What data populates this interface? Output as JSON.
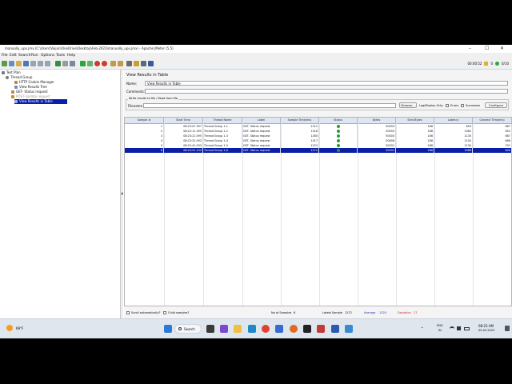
{
  "window": {
    "title": "manually_upo.jmx (C:\\Users\\Vaijan\\OneDrive\\Desktop\\Feb-2023\\manually_upo.jmx) - Apache JMeter (5.5)",
    "controls": [
      "–",
      "☐",
      "✕"
    ]
  },
  "menu": [
    "File",
    "Edit",
    "Search",
    "Run",
    "Options",
    "Tools",
    "Help"
  ],
  "toolbar": {
    "timer": "00:00:52",
    "warnings": "0",
    "threads": "0/10"
  },
  "tree": [
    {
      "label": "Test Plan",
      "icon": "test-plan-icon",
      "color": "#6e7f92"
    },
    {
      "label": "Thread Group",
      "icon": "gear-icon",
      "color": "#7a7a7a"
    },
    {
      "label": "HTTP Cookie Manager",
      "icon": "wrench-icon",
      "color": "#b58a3a"
    },
    {
      "label": "View Results Tree",
      "icon": "chart-icon",
      "color": "#6a8ebf"
    },
    {
      "label": "GET- Status request",
      "icon": "pencil-icon",
      "color": "#c9892a"
    },
    {
      "label": "POST-Update request",
      "icon": "pencil-icon",
      "color": "#c9892a"
    },
    {
      "label": "View Results in Table",
      "icon": "table-icon",
      "color": "#6a8ebf"
    }
  ],
  "panel": {
    "heading": "View Results in Table",
    "name_label": "Name:",
    "name_value": "View Results in Table",
    "comments_label": "Comments:",
    "comments_value": "",
    "group_label": "Write results to file / Read from file",
    "filename_label": "Filename",
    "filename_value": "",
    "browse_label": "Browse...",
    "log_display_label": "Log/Display Only:",
    "errors_label": "Errors",
    "successes_label": "Successes",
    "configure_label": "Configure"
  },
  "table": {
    "headers": [
      "Sample #",
      "Start Time",
      "Thread Name",
      "Label",
      "Sample Time(ms)",
      "Status",
      "Bytes",
      "Sent Bytes",
      "Latency",
      "Connect Time(ms)"
    ],
    "rows": [
      [
        "1",
        "08:23:07.397",
        "Thread Group 1-1",
        "GET- Status request",
        "1312",
        "ok",
        "50004",
        "186",
        "859",
        "667"
      ],
      [
        "2",
        "08:22:11.395",
        "Thread Group 1-2",
        "GET- Status request",
        "1316",
        "ok",
        "50004",
        "186",
        "1082",
        "652"
      ],
      [
        "3",
        "08:23:21.095",
        "Thread Group 1-3",
        "GET- Status request",
        "1260",
        "ok",
        "50004",
        "186",
        "1135",
        "687"
      ],
      [
        "4",
        "08:23:31.093",
        "Thread Group 1-4",
        "GET- Status request",
        "1317",
        "ok",
        "50608",
        "186",
        "1100",
        "668"
      ],
      [
        "5",
        "08:22:41.093",
        "Thread Group 1-5",
        "GET- Status request",
        "1253",
        "ok",
        "50031",
        "186",
        "1130",
        "701"
      ],
      [
        "6",
        "08:23:51.192",
        "Thread Group 1-6",
        "GET- Status request",
        "1272",
        "ok",
        "50031",
        "186",
        "1068",
        "640"
      ]
    ],
    "selected_row": 5
  },
  "footer": {
    "scroll_label": "Scroll automatically?",
    "child_label": "Child samples?",
    "samples_label": "No of Samples",
    "samples_value": "6",
    "latest_label": "Latest Sample",
    "latest_value": "1272",
    "average_label": "Average",
    "average_value": "1320",
    "deviation_label": "Deviation",
    "deviation_value": "27"
  },
  "taskbar": {
    "weather": "69°F",
    "search": "Search",
    "lang_top": "ENG",
    "lang_bottom": "IN",
    "time": "08:23 AM",
    "date": "09-02-2023"
  }
}
